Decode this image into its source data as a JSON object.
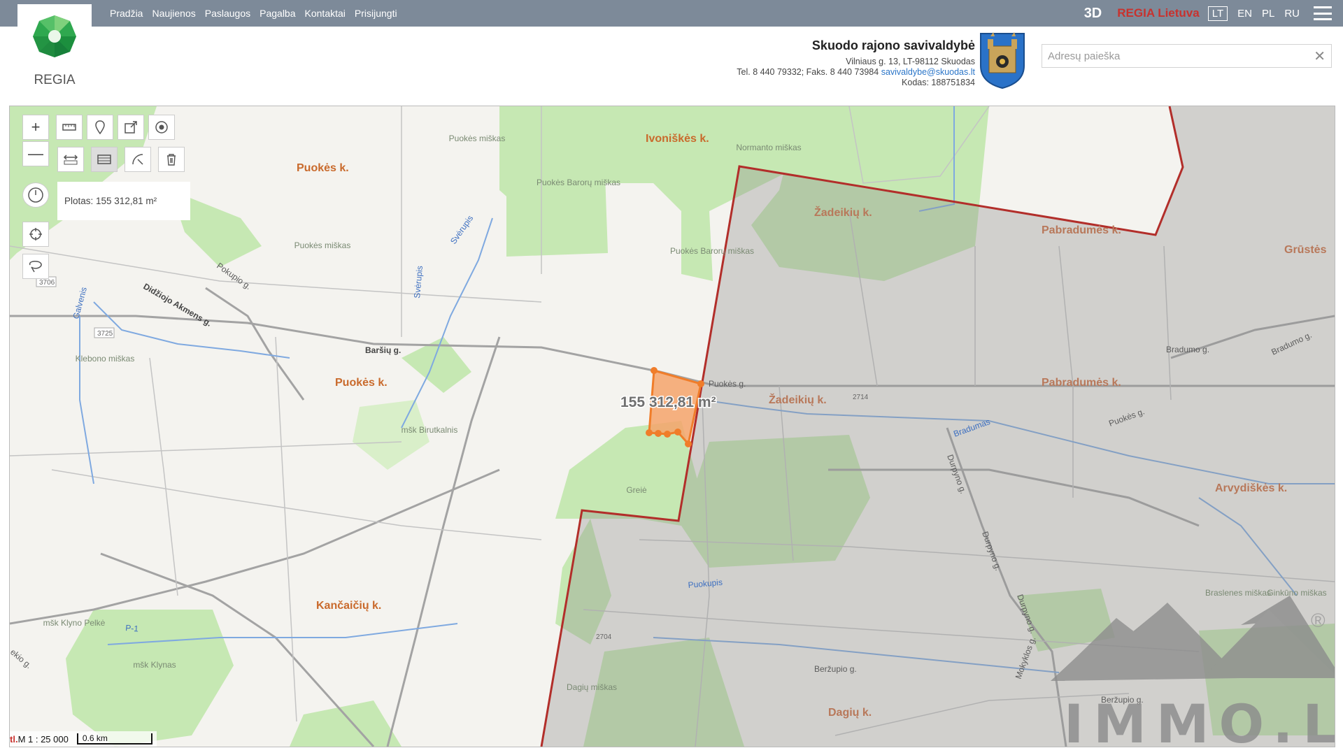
{
  "nav": {
    "items": [
      "Pradžia",
      "Naujienos",
      "Paslaugos",
      "Pagalba",
      "Kontaktai",
      "Prisijungti"
    ]
  },
  "header": {
    "logo_text": "REGIA",
    "mode_3d": "3D",
    "regia_lietuva": "REGIA Lietuva",
    "languages": [
      "LT",
      "EN",
      "PL",
      "RU"
    ],
    "active_language": "LT"
  },
  "municipality": {
    "name": "Skuodo rajono savivaldybė",
    "address": "Vilniaus g. 13, LT-98112 Skuodas",
    "phone_fax": "Tel. 8 440 79332; Faks. 8 440 73984",
    "email": "savivaldybe@skuodas.lt",
    "code": "Kodas: 188751834"
  },
  "search": {
    "placeholder": "Adresų paieška",
    "value": ""
  },
  "tools": {
    "area_label": "Plotas: 155 312,81 m²",
    "zoom_in": "+",
    "zoom_out": "—"
  },
  "map": {
    "measure_label": "155 312,81 m²",
    "village_labels": [
      "Puokės k.",
      "Ivoniškės k.",
      "Puokės k.",
      "Žadeikių k.",
      "Pabradumės k.",
      "Žadeikių k.",
      "Pabradumės k.",
      "Arvydiškės k.",
      "Kančaičių k.",
      "Dagių k.",
      "Grūstės"
    ],
    "forest_labels": [
      "Puokės miškas",
      "Puokės Barorų miškas",
      "Normanto miškas",
      "Puokės miškas",
      "Puokės Barorų miškas",
      "Klebono miškas",
      "mšk Birutkalnis",
      "Greiė",
      "mšk Klyno Pelkė",
      "mšk Klynas",
      "Dagių miškas",
      "Braslenes miškas",
      "Ginkūno miškas"
    ],
    "road_labels": [
      "Svėrupis",
      "Pokupio g.",
      "Galvenis",
      "Didžiojo Akmens g.",
      "Svėrupis",
      "Baršių g.",
      "Puokės g.",
      "Bradumo g.",
      "Bradumo g.",
      "Puokės g.",
      "Bradumas",
      "Durpyno g.",
      "Durpyno g.",
      "Durpyno g.",
      "Puokupis",
      "Beržupio g.",
      "Beržupio g.",
      "Mokyklos g.",
      "P-1",
      "ekio g."
    ],
    "road_numbers": [
      "3706",
      "3725",
      "2714",
      "2704"
    ],
    "scale_cut": "tl.",
    "scale_text": "M 1 : 25 000",
    "scale_bar": "0.6 km"
  },
  "watermark": {
    "text": "IMMO.LT",
    "registered": "®"
  },
  "colors": {
    "topbar": "#7d8a99",
    "accent_red": "#c8322e",
    "parcel": "#f5a36b",
    "parcel_stroke": "#f07d2a",
    "boundary": "#b22e2a"
  }
}
